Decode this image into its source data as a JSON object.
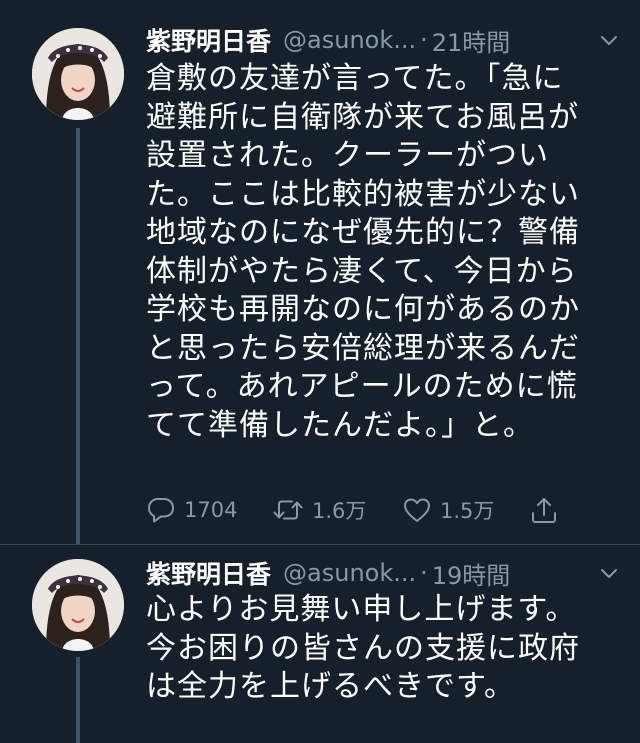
{
  "tweets": [
    {
      "name": "紫野明日香",
      "handle": "@asunok...",
      "dot": "·",
      "time": "21時間",
      "lines": [
        "倉敷の友達が言ってた。「急に",
        "避難所に自衛隊が来てお風呂が",
        "設置された。クーラーがつい",
        "た。ここは比較的被害が少ない",
        "地域なのになぜ優先的に？警備",
        "体制がやたら凄くて、今日から",
        "学校も再開なのに何があるのか",
        "と思ったら安倍総理が来るんだ",
        "って。あれアピールのために慌",
        "てて準備したんだよ。」と。"
      ],
      "actions": {
        "reply_count": "1704",
        "retweet_count": "1.6万",
        "like_count": "1.5万"
      }
    },
    {
      "name": "紫野明日香",
      "handle": "@asunok...",
      "dot": "·",
      "time": "19時間",
      "lines": [
        "心よりお見舞い申し上げます。",
        "今お困りの皆さんの支援に政府",
        "は全力を上げるべきです。"
      ]
    }
  ],
  "icons": {
    "reply": "reply-icon",
    "retweet": "retweet-icon",
    "like": "heart-icon",
    "share": "share-icon",
    "more": "chevron-down-icon"
  },
  "colors": {
    "background": "#15202b",
    "secondary_text": "#8899a6",
    "thread_line": "#3d5466"
  }
}
